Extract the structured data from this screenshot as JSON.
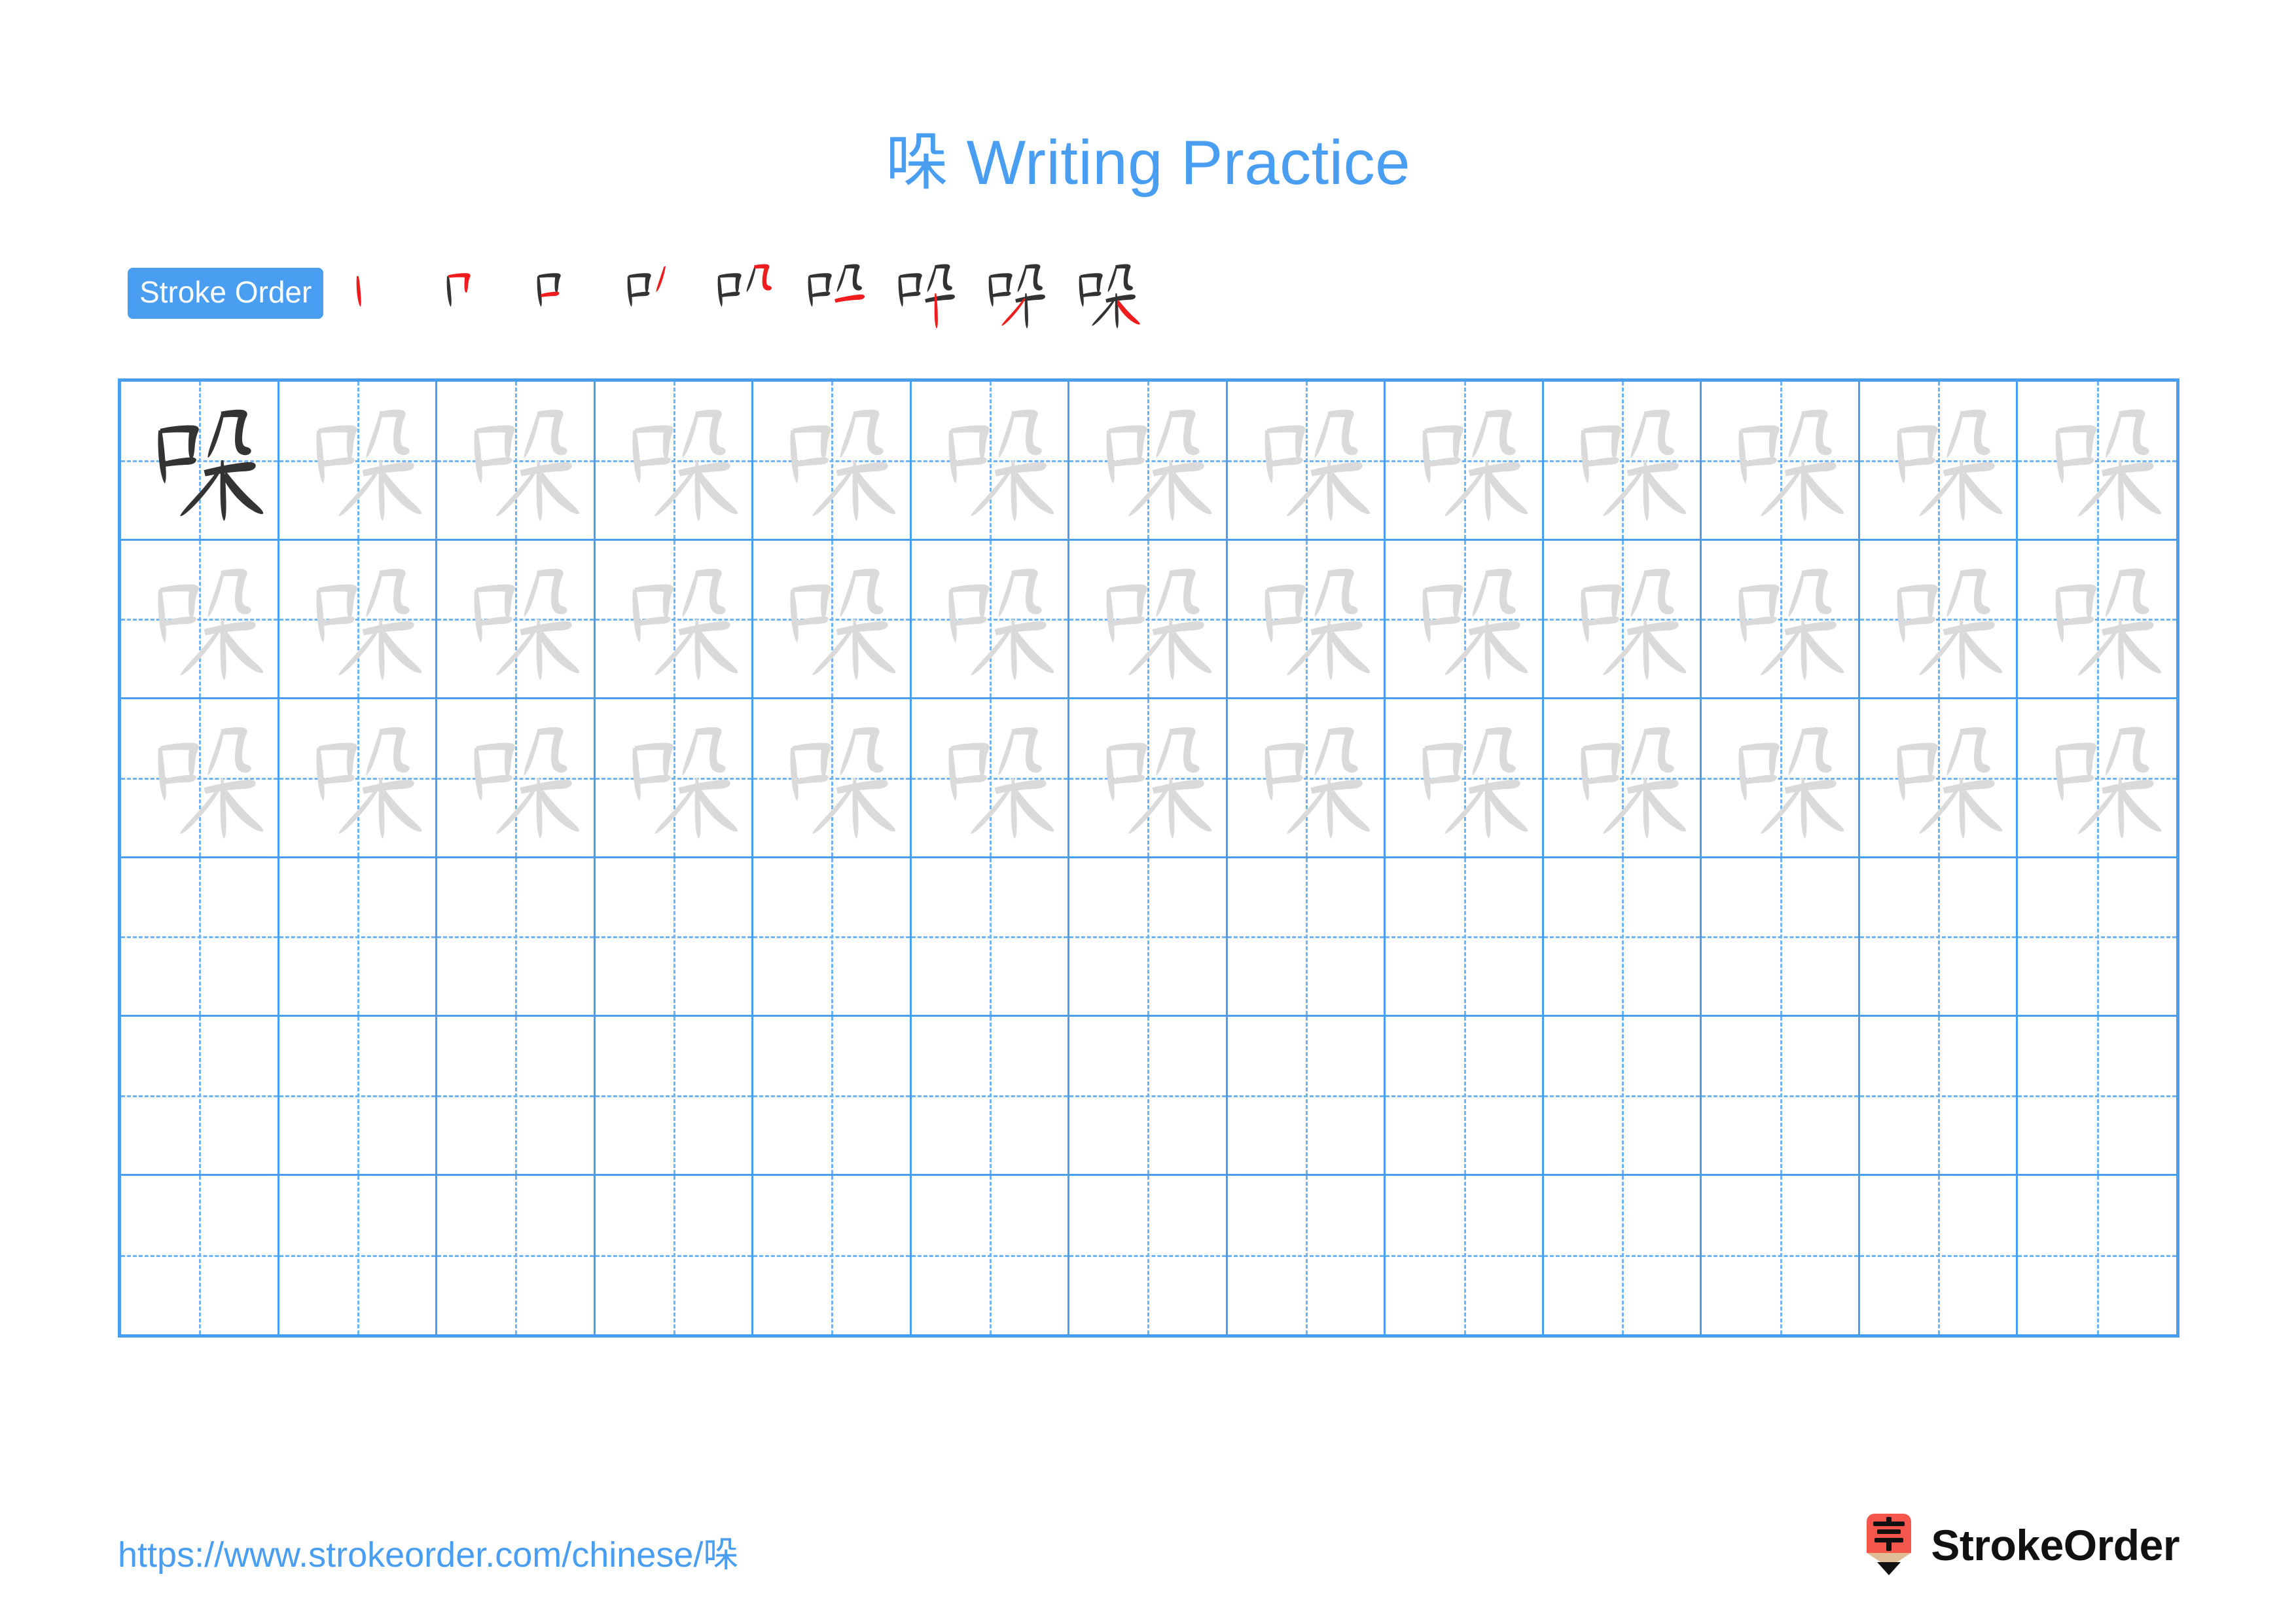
{
  "page": {
    "character": "哚",
    "title": "哚 Writing Practice",
    "accent_blue": "#4a9ef2",
    "trace_gray": "#dadada",
    "ink_black": "#333333",
    "highlight_red": "#ee1c1c"
  },
  "stroke_order": {
    "badge_label": "Stroke Order",
    "total_strokes": 9,
    "steps": [
      {
        "index": 1,
        "strokes_shown": 1,
        "new_stroke": 1,
        "name": "shu-vertical"
      },
      {
        "index": 2,
        "strokes_shown": 2,
        "new_stroke": 2,
        "name": "hengzhe-horizontal-bend"
      },
      {
        "index": 3,
        "strokes_shown": 3,
        "new_stroke": 3,
        "name": "heng-closing-bottom"
      },
      {
        "index": 4,
        "strokes_shown": 4,
        "new_stroke": 4,
        "name": "pie-left-falling"
      },
      {
        "index": 5,
        "strokes_shown": 5,
        "new_stroke": 5,
        "name": "hengzhewan-bend-hook"
      },
      {
        "index": 6,
        "strokes_shown": 6,
        "new_stroke": 6,
        "name": "heng-horizontal"
      },
      {
        "index": 7,
        "strokes_shown": 7,
        "new_stroke": 7,
        "name": "shu-long-vertical"
      },
      {
        "index": 8,
        "strokes_shown": 8,
        "new_stroke": 8,
        "name": "pie-left-falling-lower"
      },
      {
        "index": 9,
        "strokes_shown": 9,
        "new_stroke": 9,
        "name": "na-right-falling"
      }
    ]
  },
  "practice_grid": {
    "columns": 13,
    "rows": 6,
    "model_cell": {
      "row": 1,
      "column": 1,
      "style": "dark-ink"
    },
    "traced_rows": [
      1,
      2,
      3
    ],
    "blank_rows": [
      4,
      5,
      6
    ],
    "cell_style": "tian-zi-ge-dashed-crosshair"
  },
  "footer": {
    "url": "https://www.strokeorder.com/chinese/哚",
    "brand_name": "StrokeOrder",
    "logo_char": "字",
    "logo_body_color": "#f4564c",
    "logo_tip_color": "#e0bd96"
  }
}
